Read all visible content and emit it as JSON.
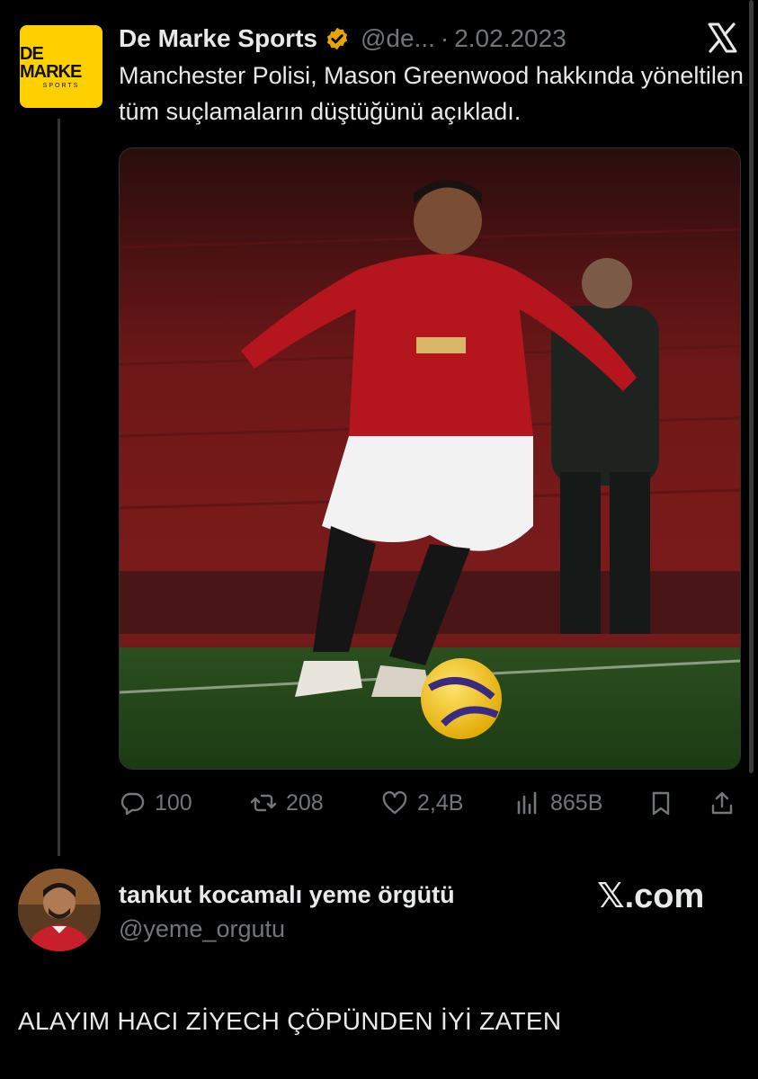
{
  "tweet": {
    "avatar_label": "DE MARKE",
    "avatar_sub": "SPORTS",
    "author": "De Marke Sports",
    "handle": "@de...",
    "separator": "·",
    "date": "2.02.2023",
    "text": "Manchester Polisi, Mason Greenwood hakkında yöneltilen tüm suçlamaların düştüğünü açıkladı.",
    "brand_icon": "x-logo-icon",
    "verified_color": "#e8a500",
    "logo_color": "#ffd000"
  },
  "actions": {
    "replies": "100",
    "retweets": "208",
    "likes": "2,4B",
    "views": "865B"
  },
  "reply": {
    "author": "tankut kocamalı yeme örgütü",
    "handle": "@yeme_orgutu",
    "watermark": "𝕏.com",
    "text": "ALAYIM HACI ZİYECH ÇÖPÜNDEN İYİ ZATEN"
  }
}
